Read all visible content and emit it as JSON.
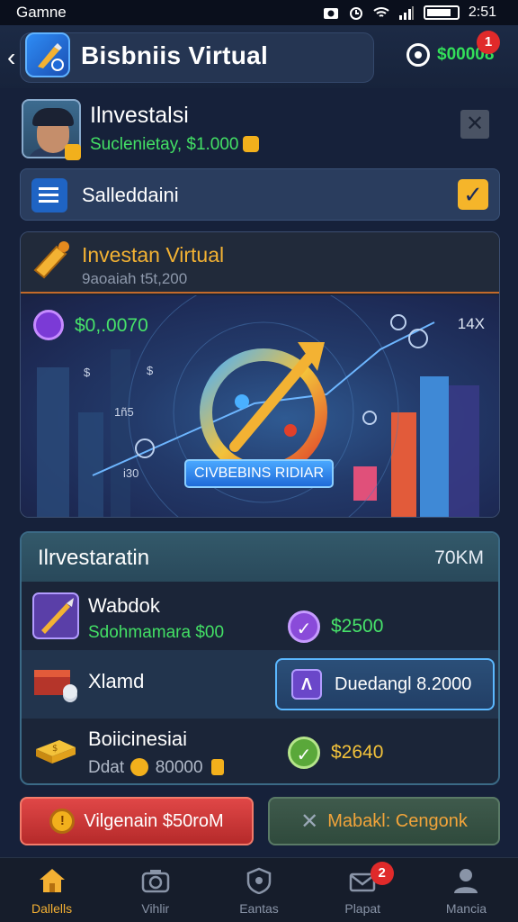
{
  "status_bar": {
    "carrier": "Gamne",
    "time": "2:51"
  },
  "header": {
    "title": "Bisbniis Virtual",
    "coins": "$00008",
    "notification_count": "1"
  },
  "profile": {
    "name": "Ilnvestalsi",
    "subtitle": "Suclenietay, $1.000"
  },
  "setting": {
    "label": "Salleddaini"
  },
  "banner": {
    "title": "Investan Virtual",
    "subtitle": "9aoaiah t5t,200",
    "value": "$0,.0070",
    "percent": "14X",
    "button": "CIVBEBINS RIDIAR",
    "labels": {
      "a": "$",
      "b": "1ñ5",
      "c": "$",
      "d": "i30"
    }
  },
  "investments": {
    "title": "Ilrvestaratin",
    "total": "70KM",
    "rows": [
      {
        "name": "Wabdok",
        "subtitle": "Sdohmamara $00",
        "value": "$2500"
      },
      {
        "name": "Xlamd",
        "button_label": "Duedangl 8.2000"
      },
      {
        "name": "Boiicinesiai",
        "subtitle": "Ddat",
        "subtitle_amount": "80000",
        "value": "$2640"
      }
    ]
  },
  "actions": {
    "primary": {
      "label": "Vilgenain $50roM"
    },
    "secondary": {
      "label": "Mabakl: Cengonk"
    }
  },
  "nav": [
    {
      "label": "Dallells",
      "icon": "home-icon"
    },
    {
      "label": "Vihlir",
      "icon": "camera-icon"
    },
    {
      "label": "Eantas",
      "icon": "shield-icon"
    },
    {
      "label": "Plapat",
      "icon": "mail-icon",
      "badge": "2"
    },
    {
      "label": "Mancia",
      "icon": "person-icon"
    }
  ],
  "colors": {
    "accent_gold": "#f3b233",
    "accent_green": "#43e065",
    "danger_red": "#e04747",
    "background": "#16213a"
  }
}
